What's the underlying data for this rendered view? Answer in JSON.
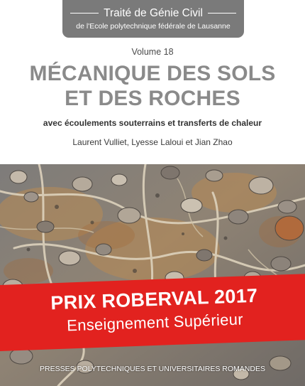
{
  "series": {
    "title": "Traité de Génie Civil",
    "subtitle": "de l'Ecole polytechnique fédérale de Lausanne"
  },
  "book": {
    "volume": "Volume 18",
    "title_line1": "MÉCANIQUE DES SOLS",
    "title_line2": "ET DES ROCHES",
    "subtitle": "avec écoulements souterrains et transferts de chaleur",
    "authors": "Laurent Vulliet, Lyesse Laloui et Jian Zhao"
  },
  "award": {
    "title": "PRIX ROBERVAL 2017",
    "subtitle": "Enseignement Supérieur"
  },
  "publisher": "PRESSES POLYTECHNIQUES ET UNIVERSITAIRES ROMANDES",
  "colors": {
    "series_band": "#7a7a7a",
    "title": "#8a8a8a",
    "award_band": "#e2221f"
  }
}
